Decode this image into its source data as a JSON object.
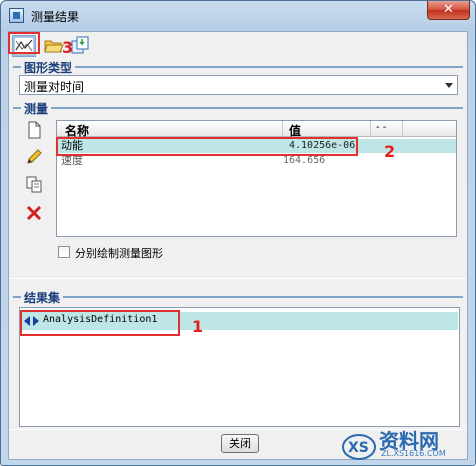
{
  "window": {
    "title": "测量结果",
    "close_glyph": "✕"
  },
  "toolbar": {
    "measure_icon": "graph-measure-icon",
    "open_icon": "folder-open-icon",
    "save_icon": "save-copy-icon"
  },
  "graph_type": {
    "header": "图形类型",
    "selected": "测量对时间"
  },
  "measure": {
    "header": "测量",
    "side_icons": [
      "new-document-icon",
      "edit-pencil-icon",
      "copy-icon",
      "delete-icon"
    ],
    "columns": [
      "名称",
      "值",
      "- -"
    ],
    "rows": [
      {
        "name": "动能",
        "value": "4.10256e-06"
      },
      {
        "name": "速度",
        "value": "164.656"
      }
    ],
    "separate_plot_label": "分别绘制测量图形"
  },
  "result_set": {
    "header": "结果集",
    "items": [
      "AnalysisDefinition1"
    ]
  },
  "footer": {
    "close_label": "关闭"
  },
  "annotations": [
    "1",
    "2",
    "3"
  ],
  "watermark": {
    "brand": "资料网",
    "url": "ZL.XS1616.COM",
    "logo_text": "XS"
  },
  "colors": {
    "selection": "#bfe6e6",
    "annotation": "#e03030",
    "header_text": "#1a3e7a"
  }
}
